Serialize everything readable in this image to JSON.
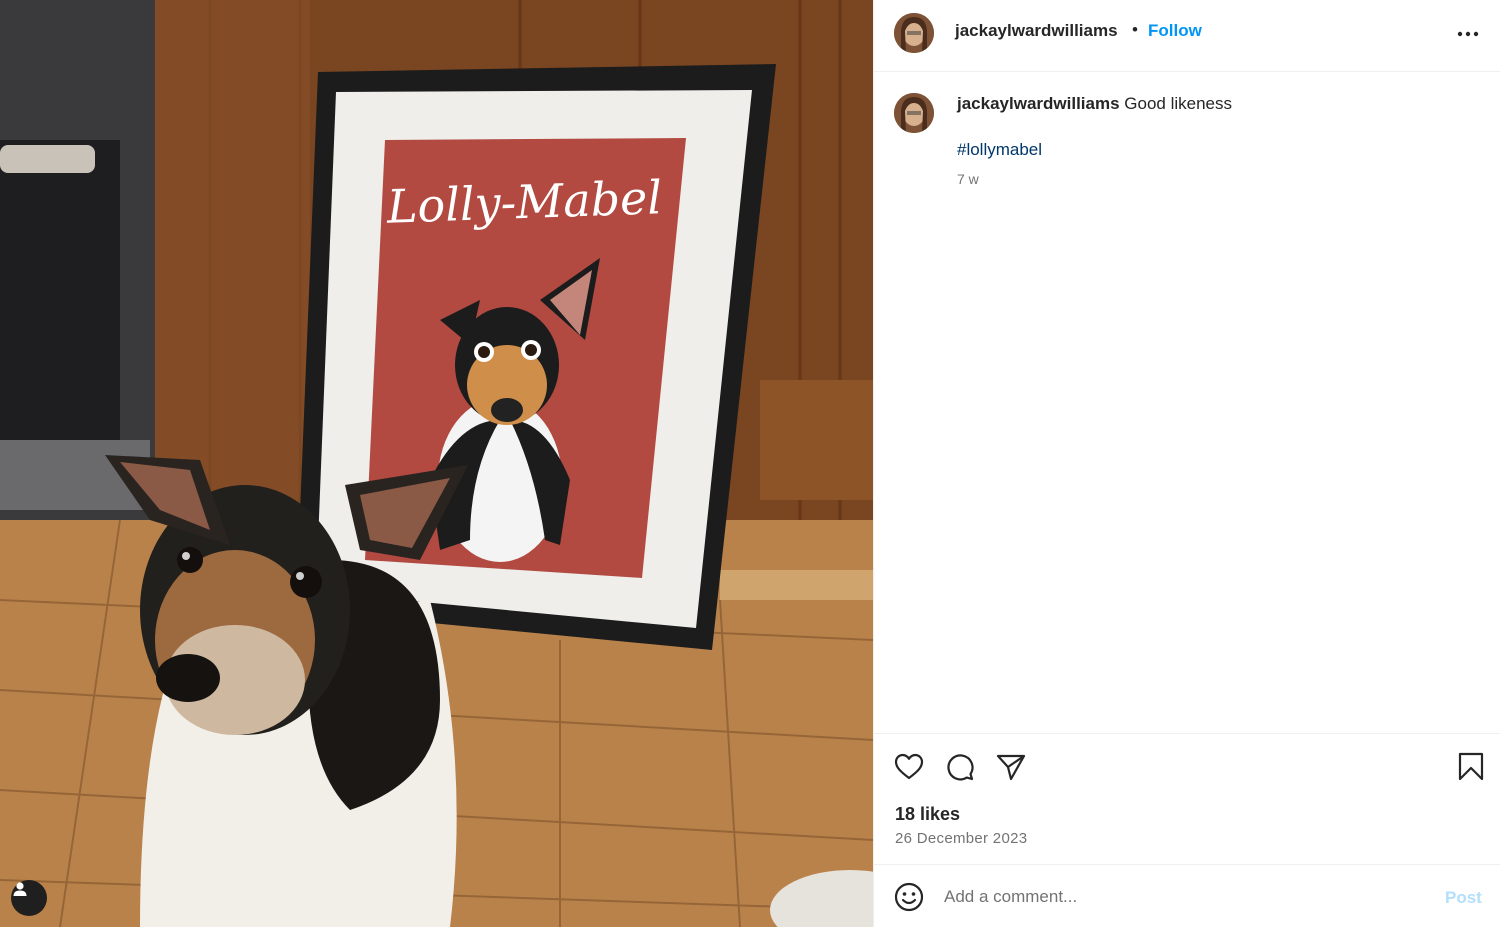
{
  "post": {
    "username": "jackaylwardwilliams",
    "separator": "•",
    "follow_label": "Follow",
    "more_icon": "more-horizontal-icon",
    "caption": {
      "username": "jackaylwardwilliams",
      "text": "Good likeness",
      "hashtag": "#lollymabel",
      "time_ago": "7 w"
    },
    "photo": {
      "frame_title": "Lolly-Mabel"
    },
    "actions": {
      "like_icon": "heart-icon",
      "comment_icon": "comment-icon",
      "share_icon": "send-icon",
      "save_icon": "bookmark-icon"
    },
    "likes": "18 likes",
    "date": "26 December 2023",
    "comment_box": {
      "placeholder": "Add a comment...",
      "post_label": "Post",
      "emoji_icon": "emoji-icon"
    }
  },
  "colors": {
    "accent": "#0095f6",
    "hashtag": "#00376b",
    "post_disabled": "#b2dffc",
    "muted": "#737373",
    "print_background": "#b24a41"
  }
}
